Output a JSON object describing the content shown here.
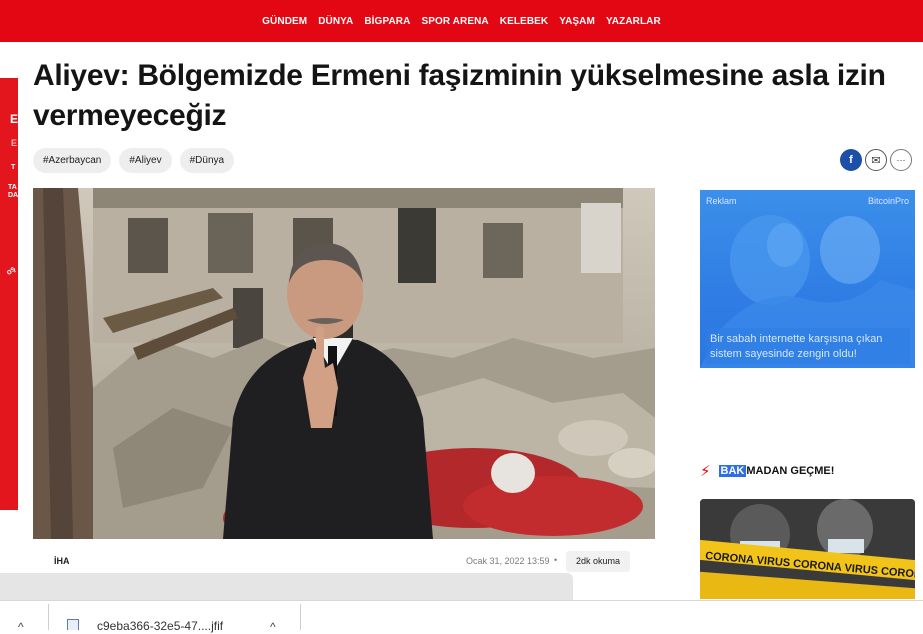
{
  "nav": {
    "items": [
      "GÜNDEM",
      "DÜNYA",
      "BİGPARA",
      "SPOR ARENA",
      "KELEBEK",
      "YAŞAM",
      "YAZARLAR"
    ]
  },
  "left_ad": {
    "fragments": [
      "E",
      "E",
      "T",
      "TA",
      "DA",
      "oş"
    ]
  },
  "article": {
    "headline": "Aliyev: Bölgemizde Ermeni faşizminin yükselmesine asla izin vermeyeceğiz",
    "tags": [
      "#Azerbaycan",
      "#Aliyev",
      "#Dünya"
    ],
    "source": "İHA",
    "date": "Ocak 31, 2022 13:59",
    "separator": "•",
    "read_time": "2dk okuma"
  },
  "share": {
    "facebook_icon": "f",
    "mail_icon": "✉",
    "more_icon": "···"
  },
  "sidebar": {
    "ad": {
      "label": "Reklam",
      "brand": "BitcoinPro",
      "text": "Bir sabah internette karşısına çıkan sistem sayesinde zengin oldu!"
    },
    "section": {
      "highlight": "BAK",
      "rest": "MADAN GEÇME!"
    },
    "corona_image_text": "CORONA VIRUS CORONA VIRUS CORONA"
  },
  "download_bar": {
    "file_name": "c9eba366-32e5-47....jfif",
    "chevron": "^"
  },
  "colors": {
    "brand_red": "#e30613",
    "facebook_blue": "#1d4fa8",
    "ad_blue": "#2f7de4",
    "highlight_blue": "#2e6fe6"
  }
}
